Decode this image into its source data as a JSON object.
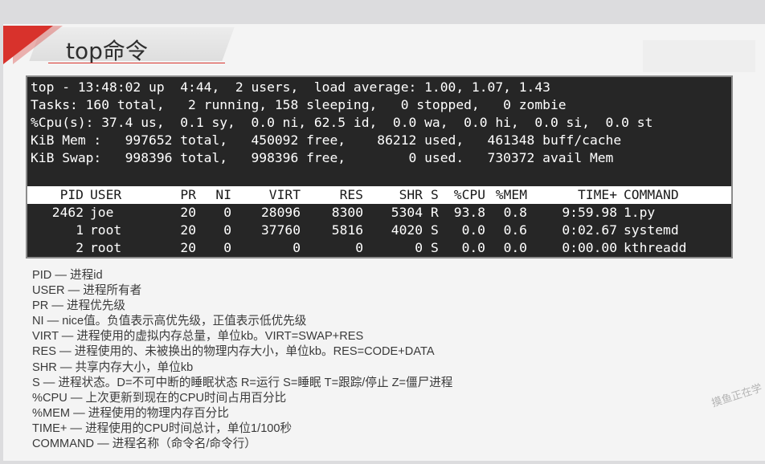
{
  "slide": {
    "title": "top命令"
  },
  "terminal": {
    "summary_lines": [
      "top - 13:48:02 up  4:44,  2 users,  load average: 1.00, 1.07, 1.43",
      "Tasks: 160 total,   2 running, 158 sleeping,   0 stopped,   0 zombie",
      "%Cpu(s): 37.4 us,  0.1 sy,  0.0 ni, 62.5 id,  0.0 wa,  0.0 hi,  0.0 si,  0.0 st",
      "KiB Mem :   997652 total,   450092 free,    86212 used,   461348 buff/cache",
      "KiB Swap:   998396 total,   998396 free,        0 used.   730372 avail Mem"
    ],
    "columns": [
      "PID",
      "USER",
      "PR",
      "NI",
      "VIRT",
      "RES",
      "SHR",
      "S",
      "%CPU",
      "%MEM",
      "TIME+",
      "COMMAND"
    ],
    "rows": [
      [
        "2462",
        "joe",
        "20",
        "0",
        "28096",
        "8300",
        "5304",
        "R",
        "93.8",
        "0.8",
        "9:59.98",
        "1.py"
      ],
      [
        "1",
        "root",
        "20",
        "0",
        "37760",
        "5816",
        "4020",
        "S",
        "0.0",
        "0.6",
        "0:02.67",
        "systemd"
      ],
      [
        "2",
        "root",
        "20",
        "0",
        "0",
        "0",
        "0",
        "S",
        "0.0",
        "0.0",
        "0:00.00",
        "kthreadd"
      ]
    ]
  },
  "notes": [
    "PID — 进程id",
    "USER — 进程所有者",
    "PR — 进程优先级",
    "NI — nice值。负值表示高优先级，正值表示低优先级",
    "VIRT — 进程使用的虚拟内存总量，单位kb。VIRT=SWAP+RES",
    "RES — 进程使用的、未被换出的物理内存大小，单位kb。RES=CODE+DATA",
    "SHR — 共享内存大小，单位kb",
    "S — 进程状态。D=不可中断的睡眠状态 R=运行 S=睡眠 T=跟踪/停止 Z=僵尸进程",
    "%CPU — 上次更新到现在的CPU时间占用百分比",
    "%MEM — 进程使用的物理内存百分比",
    "TIME+ — 进程使用的CPU时间总计，单位1/100秒",
    "COMMAND — 进程名称（命令名/命令行）"
  ],
  "watermark": "摸鱼正在学",
  "colors": {
    "accent": "#d8322c",
    "terminal_bg": "#262626",
    "terminal_fg": "#ffffff"
  }
}
